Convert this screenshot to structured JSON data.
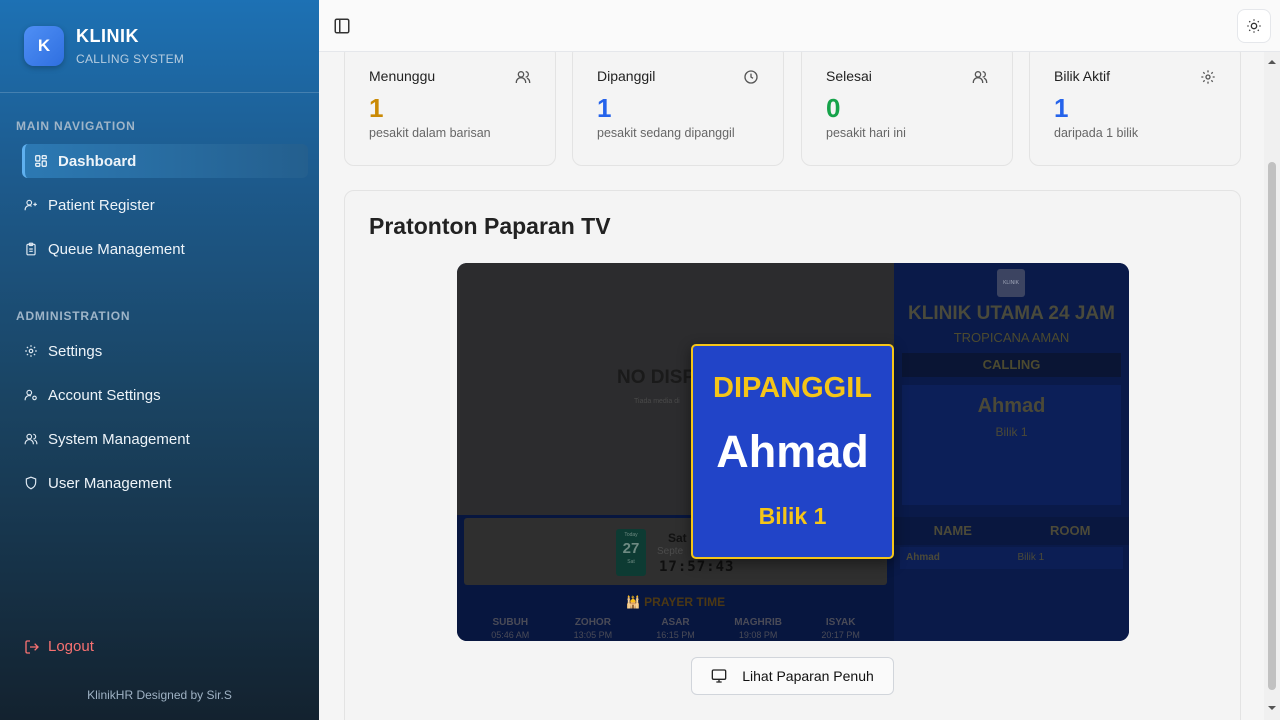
{
  "sidebar": {
    "logo_letter": "K",
    "brand_title": "KLINIK",
    "brand_sub": "CALLING SYSTEM",
    "sections": [
      {
        "title": "MAIN NAVIGATION"
      },
      {
        "title": "ADMINISTRATION"
      }
    ],
    "items": [
      {
        "label": "Dashboard",
        "icon": "dashboard-icon",
        "active": true
      },
      {
        "label": "Patient Register",
        "icon": "user-plus-icon"
      },
      {
        "label": "Queue Management",
        "icon": "clipboard-icon"
      },
      {
        "label": "Settings",
        "icon": "gear-icon"
      },
      {
        "label": "Account Settings",
        "icon": "user-key-icon"
      },
      {
        "label": "System Management",
        "icon": "users-icon"
      },
      {
        "label": "User Management",
        "icon": "shield-icon"
      }
    ],
    "logout_label": "Logout",
    "credit": "KlinikHR Designed by Sir.S"
  },
  "stats": [
    {
      "label": "Menunggu",
      "value": "1",
      "desc": "pesakit dalam barisan",
      "color": "#ca8a04",
      "icon": "users-icon"
    },
    {
      "label": "Dipanggil",
      "value": "1",
      "desc": "pesakit sedang dipanggil",
      "color": "#2563eb",
      "icon": "clock-icon"
    },
    {
      "label": "Selesai",
      "value": "0",
      "desc": "pesakit hari ini",
      "color": "#16a34a",
      "icon": "users-icon"
    },
    {
      "label": "Bilik Aktif",
      "value": "1",
      "desc": "daripada 1 bilik",
      "color": "#2563eb",
      "icon": "gear-icon"
    }
  ],
  "panel": {
    "title": "Pratonton Paparan TV",
    "full_button": "Lihat Paparan Penuh"
  },
  "tv": {
    "no_display": "NO DISP",
    "no_display_sub": "Tiada media di",
    "cal_top": "Today",
    "cal_day": "27",
    "cal_bottom": "Sat",
    "day_name": "Sat",
    "month_name": "Septe",
    "clock": "17:57:43",
    "prayer_title": "🕌 PRAYER TIME",
    "prayers": [
      {
        "name": "SUBUH",
        "time": "05:46 AM"
      },
      {
        "name": "ZOHOR",
        "time": "13:05 PM"
      },
      {
        "name": "ASAR",
        "time": "16:15 PM"
      },
      {
        "name": "MAGHRIB",
        "time": "19:08 PM"
      },
      {
        "name": "ISYAK",
        "time": "20:17 PM"
      }
    ],
    "clinic_logo_text": "KLINIK",
    "clinic_name": "KLINIK UTAMA 24 JAM",
    "clinic_location": "TROPICANA AMAN",
    "calling_label": "CALLING",
    "current_name": "Ahmad",
    "current_room": "Bilik 1",
    "table_headers": [
      "NAME",
      "ROOM"
    ],
    "table_rows": [
      {
        "name": "Ahmad",
        "room": "Bilik 1"
      }
    ],
    "modal_label": "DIPANGGIL",
    "modal_name": "Ahmad",
    "modal_room": "Bilik 1",
    "accent": "#f5c518"
  }
}
